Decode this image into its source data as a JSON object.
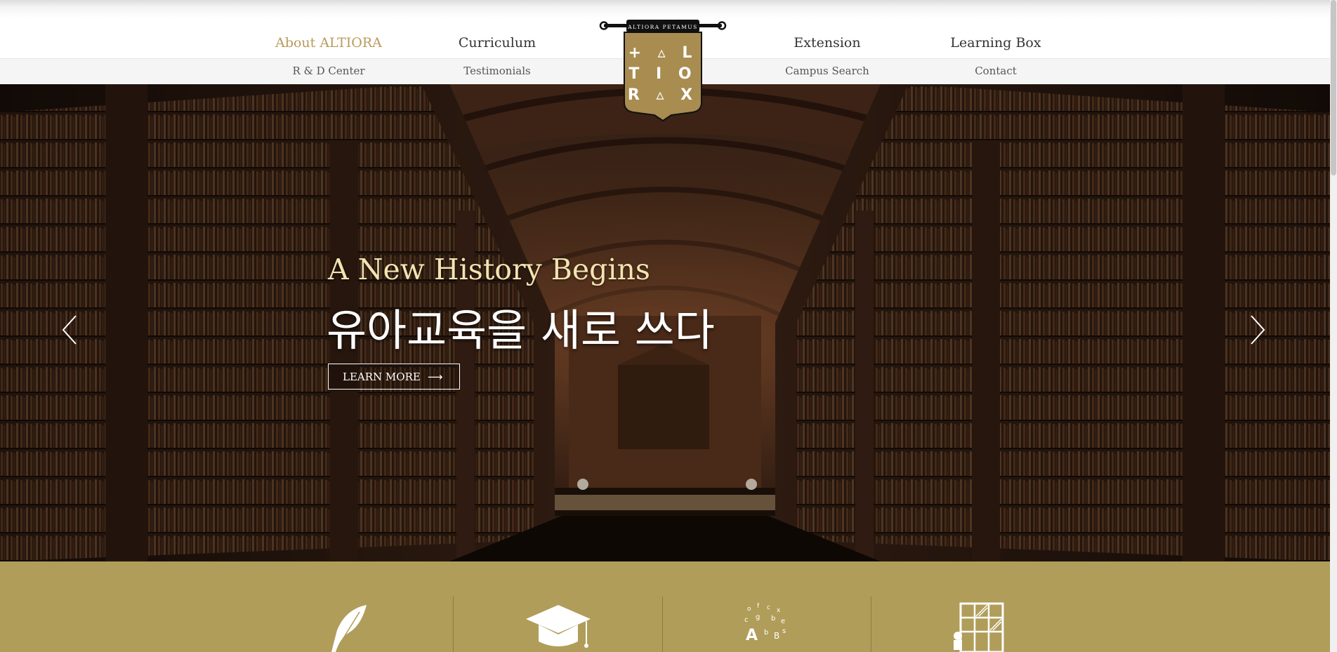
{
  "nav": {
    "primary": [
      {
        "label": "About ALTIORA",
        "active": true
      },
      {
        "label": "Curriculum"
      },
      {
        "label": "Extension"
      },
      {
        "label": "Learning Box"
      }
    ],
    "secondary": [
      {
        "label": "R & D Center"
      },
      {
        "label": "Testimonials"
      },
      {
        "label": "Campus Search"
      },
      {
        "label": "Contact"
      }
    ]
  },
  "logo": {
    "banner": "ALTIORA PETAMUS",
    "rows": [
      "+ ▵ L",
      "T I O",
      "R ▵ X"
    ]
  },
  "hero": {
    "subtitle": "A New History Begins",
    "title": "유아교육을 새로 쓰다",
    "cta_label": "LEARN MORE",
    "cta_arrow": "⟶",
    "prev_icon": "chevron-left-icon",
    "next_icon": "chevron-right-icon"
  },
  "features": {
    "icons": [
      "quill-icon",
      "graduation-cap-icon",
      "alphabet-letters-icon",
      "chess-grid-icon"
    ]
  },
  "colors": {
    "accent": "#b99a5c",
    "band": "#b09d5a",
    "hero_subtitle": "#f3e3b0"
  }
}
